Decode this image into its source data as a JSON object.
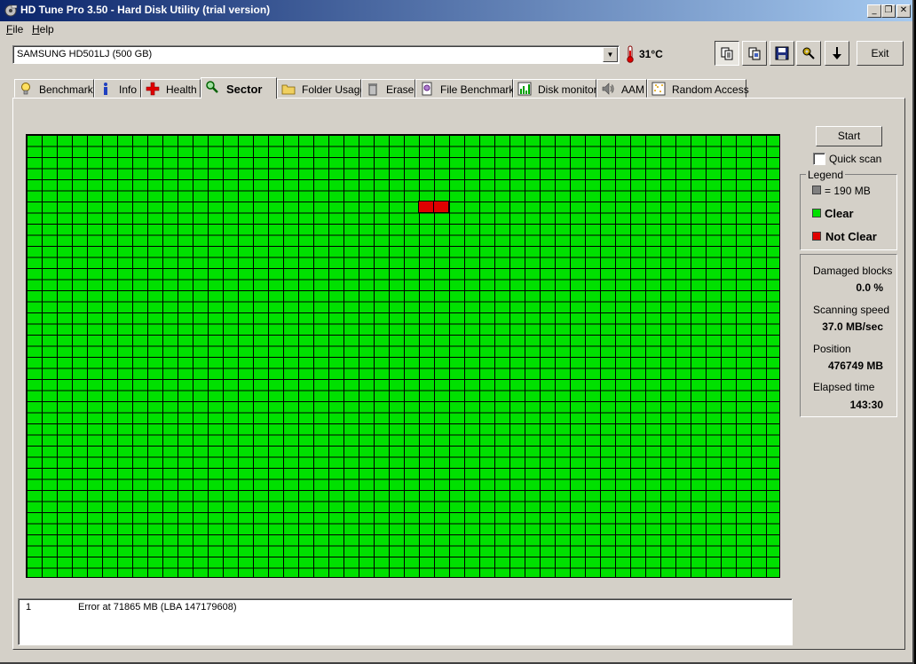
{
  "window": {
    "title": "HD Tune Pro 3.50 - Hard Disk Utility (trial version)",
    "min": "_",
    "restore": "❐",
    "close": "✕"
  },
  "menu": [
    {
      "label": "File",
      "underline": "F",
      "rest": "ile"
    },
    {
      "label": "Help",
      "underline": "H",
      "rest": "elp"
    }
  ],
  "toolbar": {
    "drive": "SAMSUNG HD501LJ (500 GB)",
    "temperature": "31°C",
    "exit_label": "Exit"
  },
  "tabs": [
    {
      "label": "Benchmark",
      "icon": "lightbulb-icon"
    },
    {
      "label": "Info",
      "icon": "info-icon"
    },
    {
      "label": "Health",
      "icon": "health-cross-icon"
    },
    {
      "label": "Sector",
      "icon": "magnifier-icon",
      "active": true
    },
    {
      "label": "Folder Usage",
      "icon": "folder-icon"
    },
    {
      "label": "Erase",
      "icon": "trash-icon"
    },
    {
      "label": "File Benchmark",
      "icon": "file-benchmark-icon"
    },
    {
      "label": "Disk monitor",
      "icon": "disk-monitor-icon"
    },
    {
      "label": "AAM",
      "icon": "speaker-icon"
    },
    {
      "label": "Random Access",
      "icon": "random-access-icon"
    }
  ],
  "scan": {
    "start_label": "Start",
    "quick_scan_label": "Quick scan",
    "quick_scan_checked": false
  },
  "legend": {
    "title": "Legend",
    "block_size": "= 190 MB",
    "clear": "Clear",
    "not_clear": "Not Clear",
    "colors": {
      "block": "#808080",
      "clear": "#00e000",
      "not_clear": "#e00000"
    }
  },
  "stats": {
    "damaged_label": "Damaged blocks",
    "damaged_value": "0.0 %",
    "speed_label": "Scanning speed",
    "speed_value": "37.0 MB/sec",
    "position_label": "Position",
    "position_value": "476749 MB",
    "elapsed_label": "Elapsed time",
    "elapsed_value": "143:30"
  },
  "block_map": {
    "columns": 50,
    "rows": 40,
    "damaged_blocks": [
      {
        "row": 6,
        "col": 26
      },
      {
        "row": 6,
        "col": 27
      }
    ]
  },
  "log": [
    {
      "index": "1",
      "message": "Error at 71865 MB (LBA 147179608)"
    }
  ]
}
